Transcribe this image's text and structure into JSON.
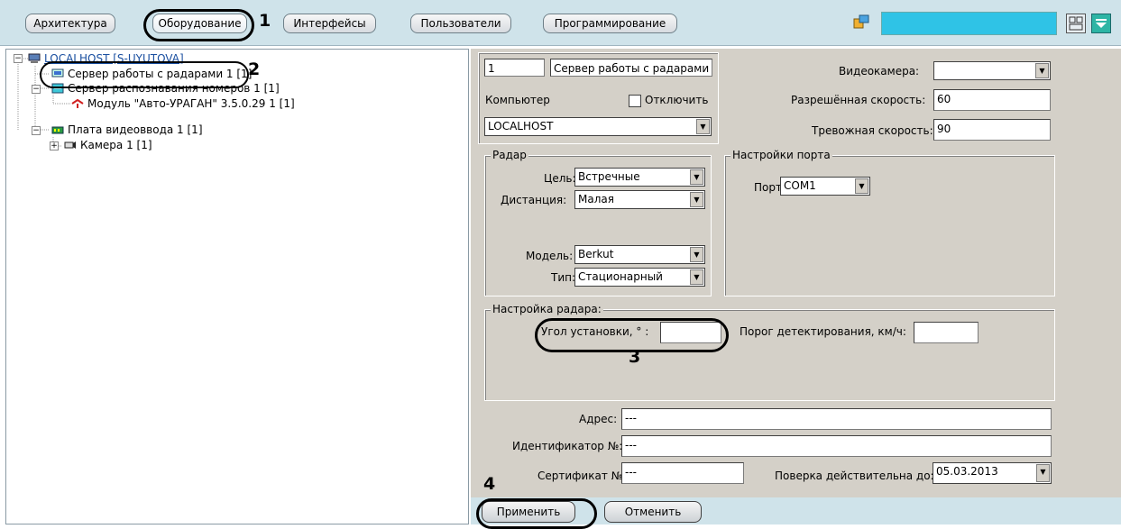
{
  "toolbar": {
    "tabs": [
      {
        "label": "Архитектура"
      },
      {
        "label": "Оборудование"
      },
      {
        "label": "Интерфейсы"
      },
      {
        "label": "Пользователи"
      },
      {
        "label": "Программирование"
      }
    ]
  },
  "callouts": {
    "one": "1",
    "two": "2",
    "three": "3",
    "four": "4"
  },
  "tree": {
    "root": "LOCALHOST [S-UYUTOVA]",
    "radar_server": "Сервер работы с радарами 1 [1]",
    "plate_server": "Сервер распознавания номеров 1 [1]",
    "module": "Модуль \"Авто-УРАГАН\" 3.5.0.29 1 [1]",
    "capture_board": "Плата видеоввода 1 [1]",
    "camera": "Камера 1 [1]"
  },
  "form": {
    "id_value": "1",
    "name_value": "Сервер работы с радарами",
    "computer_label": "Компьютер",
    "disable_label": "Отключить",
    "computer_value": "LOCALHOST",
    "camera_label": "Видеокамера:",
    "camera_value": "",
    "allowed_speed_label": "Разрешённая скорость:",
    "allowed_speed_value": "60",
    "alarm_speed_label": "Тревожная скорость:",
    "alarm_speed_value": "90",
    "radar_group": "Радар",
    "target_label": "Цель:",
    "target_value": "Встречные",
    "distance_label": "Дистанция:",
    "distance_value": "Малая",
    "model_label": "Модель:",
    "model_value": "Berkut",
    "type_label": "Тип:",
    "type_value": "Стационарный",
    "port_group": "Настройки порта",
    "port_label": "Порт",
    "port_value": "COM1",
    "radar_setup_group": "Настройка радара:",
    "angle_label": "Угол установки, ° :",
    "angle_value": "",
    "threshold_label": "Порог детектирования, км/ч:",
    "threshold_value": "",
    "address_label": "Адрес:",
    "address_value": "---",
    "identifier_label": "Идентификатор №:",
    "identifier_value": "---",
    "certificate_label": "Сертификат №:",
    "certificate_value": "---",
    "verification_label": "Поверка действительна до:",
    "verification_value": "05.03.2013"
  },
  "buttons": {
    "apply": "Применить",
    "cancel": "Отменить"
  },
  "colors": {
    "toolbar_bg": "#cfe3ea",
    "panel_bg": "#d4d0c8",
    "search_box": "#2fc3e6"
  }
}
